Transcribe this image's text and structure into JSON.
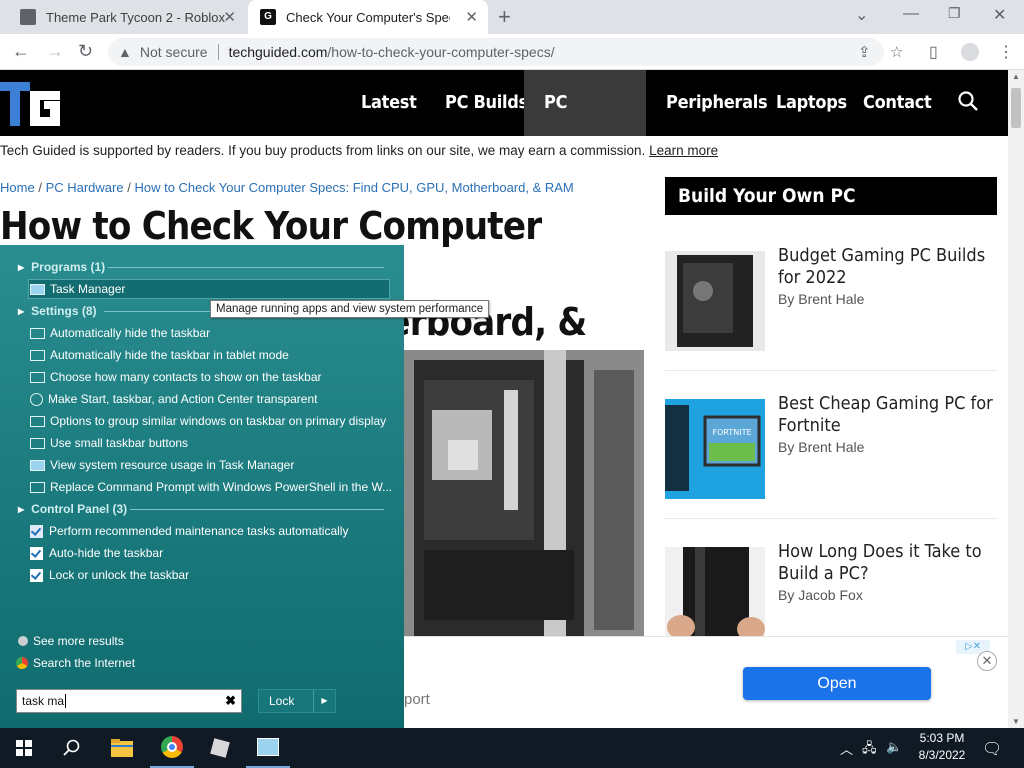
{
  "browser": {
    "tabs": [
      {
        "title": "Theme Park Tycoon 2 - Roblox",
        "active": false
      },
      {
        "title": "Check Your Computer's Specs: CPU",
        "active": true
      }
    ],
    "security": "Not secure",
    "url_domain": "techguided.com",
    "url_path": "/how-to-check-your-computer-specs/"
  },
  "site": {
    "logo": "TG",
    "nav": [
      "Latest",
      "PC Builds",
      "PC Hardware",
      "Peripherals",
      "Laptops",
      "Contact"
    ],
    "active_nav": "PC Hardware",
    "disclosure": "Tech Guided is supported by readers. If you buy products from links on our site, we may earn a commission.",
    "disclosure_link": "Learn more",
    "breadcrumb": [
      "Home",
      "PC Hardware",
      "How to Check Your Computer Specs: Find CPU, GPU, Motherboard, & RAM"
    ],
    "title_line1": "How to Check Your Computer Specs:",
    "title_line2": "Find CPU, GPU, Motherboard, & RAM",
    "sidebar_heading": "Build Your Own PC",
    "cards": [
      {
        "title": "Budget Gaming PC Builds for 2022",
        "author": "By Brent Hale"
      },
      {
        "title": "Best Cheap Gaming PC for Fortnite",
        "author": "By Brent Hale"
      },
      {
        "title": "How Long Does it Take to Build a PC?",
        "author": "By Jacob Fox"
      }
    ],
    "fortnite_label": "FORTNITE"
  },
  "ad": {
    "button": "Open",
    "partial_text": "port",
    "close": "✕",
    "badge": "▷✕"
  },
  "start_menu": {
    "groups": {
      "programs": "Programs (1)",
      "settings": "Settings (8)",
      "control_panel": "Control Panel (3)"
    },
    "programs": [
      "Task Manager"
    ],
    "settings": [
      "Automatically hide the taskbar",
      "Automatically hide the taskbar in tablet mode",
      "Choose how many contacts to show on the taskbar",
      "Make Start, taskbar, and Action Center transparent",
      "Options to group similar windows on taskbar on primary display",
      "Use small taskbar buttons",
      "View system resource usage in Task Manager",
      "Replace Command Prompt with Windows PowerShell in the W..."
    ],
    "control_panel": [
      "Perform recommended maintenance tasks automatically",
      "Auto-hide the taskbar",
      "Lock or unlock the taskbar"
    ],
    "tooltip": "Manage running apps and view system performance",
    "see_more": "See more results",
    "search_internet": "Search the Internet",
    "search_value": "task ma",
    "lock_label": "Lock"
  },
  "taskbar": {
    "time": "5:03 PM",
    "date": "8/3/2022"
  }
}
